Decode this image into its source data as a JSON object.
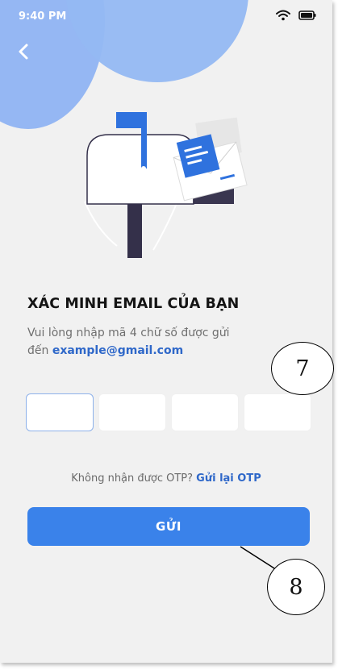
{
  "status_bar": {
    "time": "9:40 PM"
  },
  "verify": {
    "title": "XÁC MINH EMAIL CỦA BẠN",
    "desc_line1": "Vui lòng nhập mã 4 chữ số được gửi",
    "desc_prefix": "đến",
    "email": "example@gmail.com"
  },
  "otp": {
    "digits": [
      "",
      "",
      "",
      ""
    ]
  },
  "resend": {
    "prompt": "Không nhận được OTP?",
    "link": "Gửi lại OTP"
  },
  "submit_label": "GỬI",
  "annotations": {
    "callout_7": "7",
    "callout_8": "8"
  },
  "colors": {
    "primary": "#3a82ea",
    "link": "#2f68c9",
    "blob": "#8fb3f2",
    "background": "#f1f1f1"
  }
}
